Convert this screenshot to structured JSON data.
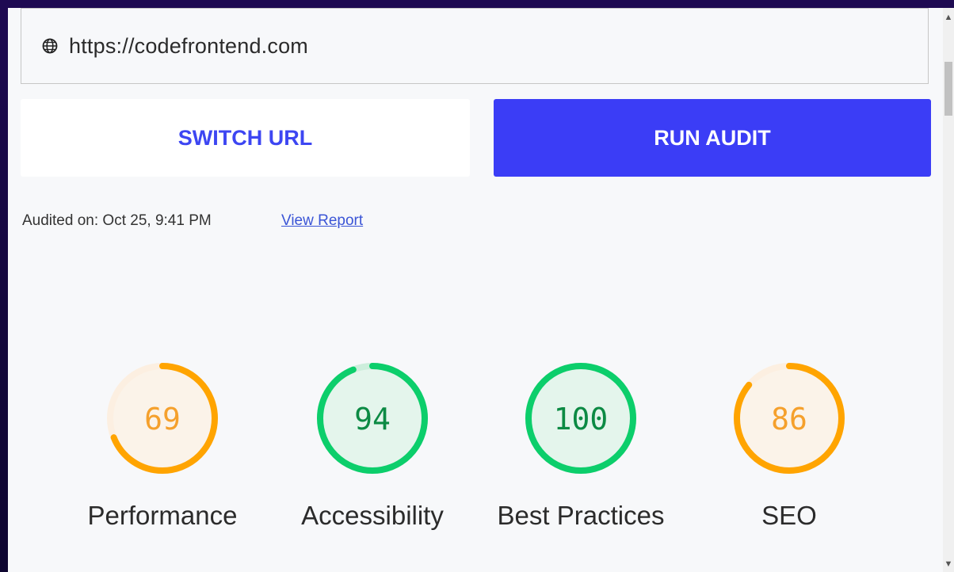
{
  "url_bar": {
    "icon": "globe-icon",
    "value": "https://codefrontend.com"
  },
  "buttons": {
    "switch_url": "SWITCH URL",
    "run_audit": "RUN AUDIT"
  },
  "meta": {
    "audited_on": "Audited on: Oct 25, 9:41 PM",
    "view_report": "View Report"
  },
  "scores": [
    {
      "label": "Performance",
      "value": 69,
      "color": "#ffa400",
      "track": "#fcefe1",
      "fill": "#fbf3e9",
      "text_color": "#f5a02c"
    },
    {
      "label": "Accessibility",
      "value": 94,
      "color": "#0cce6b",
      "track": "#cdeedc",
      "fill": "#e4f5ec",
      "text_color": "#0c8a44"
    },
    {
      "label": "Best Practices",
      "value": 100,
      "color": "#0cce6b",
      "track": "#cdeedc",
      "fill": "#e4f5ec",
      "text_color": "#0c8a44"
    },
    {
      "label": "SEO",
      "value": 86,
      "color": "#ffa400",
      "track": "#fcefe1",
      "fill": "#fbf3e9",
      "text_color": "#f5a02c"
    }
  ]
}
